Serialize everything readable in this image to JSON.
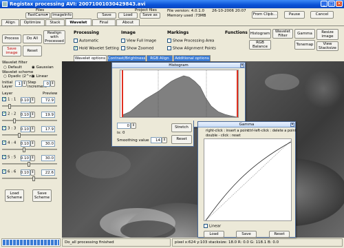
{
  "window": {
    "title": "Registax processing AVI: 20071001030429843.avi"
  },
  "menu": {
    "files_label": "Files",
    "files_button": "FastCams",
    "images_button": "ImageInfo",
    "project_files_label": "Project files",
    "save_button": "Save",
    "load_button": "Load",
    "save_as_button": "Save as",
    "file_version": "File version: 4.0.1.0",
    "date": "26-10-2006 20:07",
    "memory": "Memory used :73MB",
    "from_clipb": "From Clipb...",
    "pause": "Pause",
    "cancel": "Cancel"
  },
  "tabs": [
    "Align",
    "Optimize",
    "Stack",
    "Wavelet",
    "Final",
    "About"
  ],
  "controls": {
    "process": "Process",
    "do_all": "Do All",
    "realign": "Realign with Processed",
    "save_image": "Save image",
    "reset": "Reset"
  },
  "processing": {
    "title": "Processing",
    "automatic": "Automatic",
    "hold_wavelet": "Hold Wavelet Setting"
  },
  "image": {
    "title": "Image",
    "full": "View Full Image",
    "zoomed": "Show Zoomed"
  },
  "markings": {
    "title": "Markings",
    "area": "Show Processing Area",
    "points": "Show Alignment Points"
  },
  "functions": {
    "title": "Functions",
    "histogram": "Histogram",
    "wavelet_filter": "Wavelet Filter",
    "gamma": "Gamma",
    "resize": "Resize image",
    "rgb_balance": "RGB Balance",
    "tonemap": "Tonemap",
    "view_stacksize": "View Stacksize"
  },
  "subtabs": [
    "Wavelet options",
    "Contrast/Brightness",
    "RGB Align",
    "Additional options"
  ],
  "wavelet": {
    "filter_label": "Wavelet filter",
    "default": "Default",
    "gaussian": "Gaussian",
    "scheme_label": "Wavelet scheme",
    "dyadic": "Dyadic (2^n)",
    "linear": "Linear",
    "initial_layer": "Initial Layer",
    "initial_value": "1",
    "step_increment": "Step increment",
    "step_value": "0",
    "layer_header": "Layer",
    "preview_header": "Preview",
    "layers": [
      {
        "label": "1 : 1",
        "value": "0.10",
        "preview": "72.9"
      },
      {
        "label": "2 : 2",
        "value": "0.10",
        "preview": "19.9"
      },
      {
        "label": "3 : 3",
        "value": "0.10",
        "preview": "17.9"
      },
      {
        "label": "4 : 4",
        "value": "0.10",
        "preview": "30.0"
      },
      {
        "label": "5 : 5",
        "value": "0.10",
        "preview": "30.0"
      },
      {
        "label": "6 : 6",
        "value": "0.10",
        "preview": "22.6"
      }
    ],
    "load_scheme": "Load Scheme",
    "save_scheme": "Save Scheme"
  },
  "histogram": {
    "title": "Histogram",
    "low_value": "0",
    "is_label": "is: 0",
    "stretch": "Stretch",
    "smoothing_label": "Smoothing value",
    "smoothing_value": "14",
    "reset": "Reset"
  },
  "gamma": {
    "title": "Gamma",
    "help1": "right-click : insert a point",
    "help2": "ctrl-left-click : delete a point",
    "help3": "double - click : reset",
    "linear": "Linear",
    "load": "Load",
    "save": "Save",
    "reset": "Reset"
  },
  "status": {
    "progress": 1,
    "message": "Do_all processing finished",
    "pixel_info": "pixel x:624 y:103 stacksize: 18.0 R: 0.0 G: 118.1 B: 0.0"
  }
}
